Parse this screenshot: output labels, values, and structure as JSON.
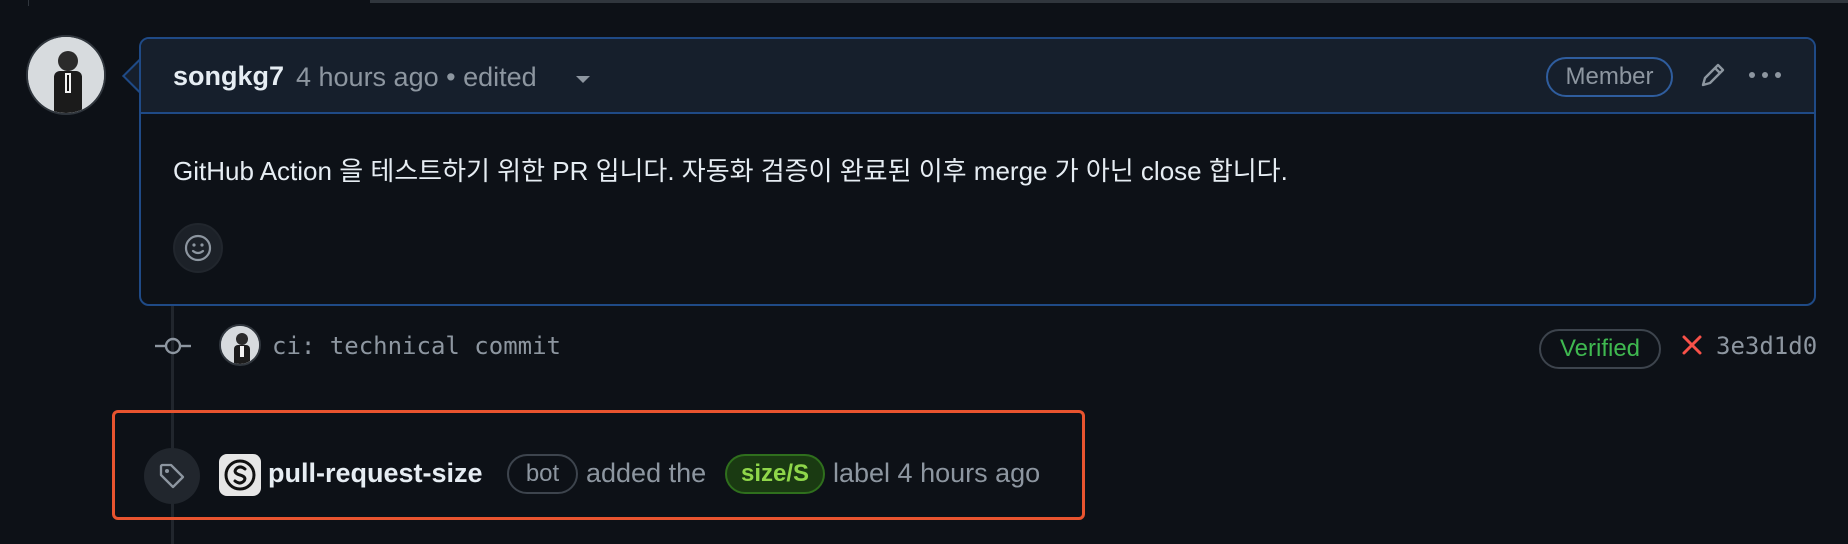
{
  "comment": {
    "author": "songkg7",
    "meta": "4 hours ago • edited",
    "member_badge": "Member",
    "body": "GitHub Action 을 테스트하기 위한 PR 입니다. 자동화 검증이 완료된 이후 merge 가 아닌 close 합니다."
  },
  "commit": {
    "message": "ci: technical commit",
    "verified_badge": "Verified",
    "sha": "3e3d1d0"
  },
  "label_event": {
    "actor": "pull-request-size",
    "actor_badge": "bot",
    "action_text": "added the",
    "label": "size/S",
    "suffix": "label 4 hours ago"
  },
  "colors": {
    "background": "#0d1117",
    "comment_border": "#1f4a86",
    "verified": "#3fb950",
    "label_text": "#8fd64a",
    "highlight": "#e8542f",
    "fail_x": "#f85149"
  },
  "icons": [
    "edit-pencil-icon",
    "kebab-menu-icon",
    "smiley-icon",
    "commit-node-icon",
    "x-fail-icon",
    "tag-icon",
    "bot-logo-icon"
  ]
}
